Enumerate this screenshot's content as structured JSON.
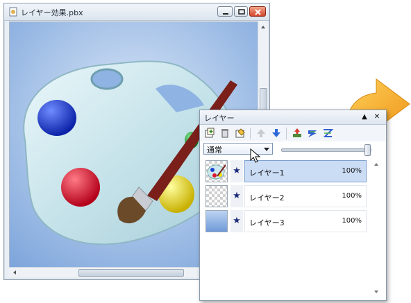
{
  "window": {
    "title": "レイヤー効果.pbx",
    "icon": "app-document-icon",
    "buttons": [
      "minimize-icon",
      "maximize-icon",
      "close-icon"
    ]
  },
  "canvas": {
    "image": "paint-palette-with-brush",
    "palette_color": "#cde8ee",
    "background_color": "#8fb3e3",
    "paint_colors": [
      "#1c3fd0",
      "#e01530",
      "#f2e00a",
      "#1fa83a"
    ]
  },
  "layers_panel": {
    "title": "レイヤー",
    "title_buttons": [
      "collapse-icon",
      "close-icon"
    ],
    "toolbar_icons": [
      "new-layer-icon",
      "delete-layer-icon",
      "layer-properties-icon",
      "move-layer-up-icon",
      "move-layer-down-icon",
      "merge-down-icon",
      "merge-visible-icon",
      "flatten-icon"
    ],
    "blend_mode": "通常",
    "opacity_fraction": 1.0,
    "layers": [
      {
        "name": "レイヤー1",
        "opacity": "100%",
        "selected": true,
        "thumb": "palette"
      },
      {
        "name": "レイヤー2",
        "opacity": "100%",
        "selected": false,
        "thumb": "transparent"
      },
      {
        "name": "レイヤー3",
        "opacity": "100%",
        "selected": false,
        "thumb": "gradient"
      }
    ],
    "visibility_icon": "star-icon"
  },
  "colors": {
    "selection": "#cbdcf5",
    "accent_arrow": "#f2a51c"
  }
}
